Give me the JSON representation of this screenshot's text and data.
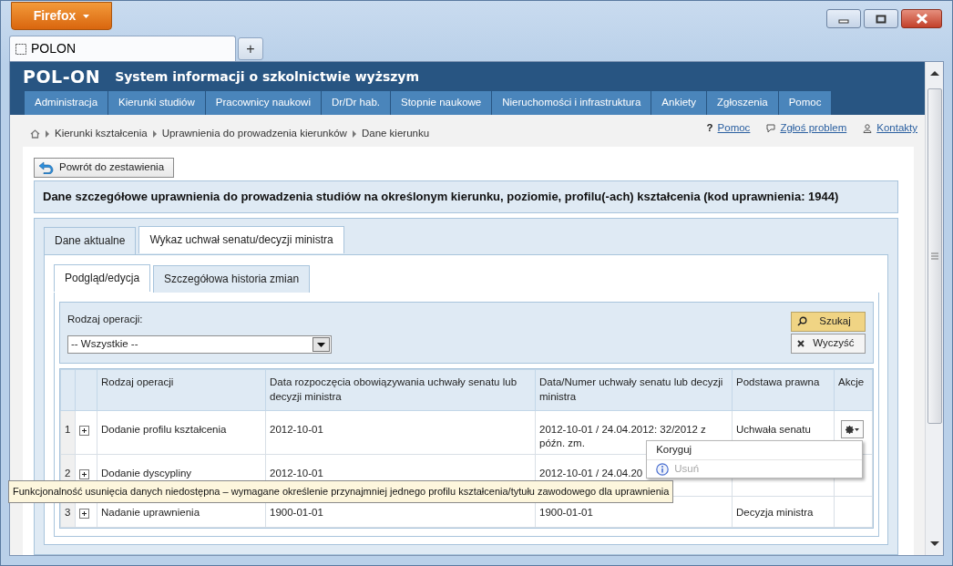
{
  "browser": {
    "menu_button": "Firefox",
    "tabs": [
      {
        "label": "POLON",
        "selected": true
      }
    ],
    "new_tab": "+"
  },
  "header": {
    "logo": "POL-ON",
    "title": "System informacji o szkolnictwie wyższym"
  },
  "nav": [
    {
      "label": "Administracja"
    },
    {
      "label": "Kierunki studiów"
    },
    {
      "label": "Pracownicy naukowi"
    },
    {
      "label": "Dr/Dr hab."
    },
    {
      "label": "Stopnie naukowe"
    },
    {
      "label": "Nieruchomości i infrastruktura"
    },
    {
      "label": "Ankiety"
    },
    {
      "label": "Zgłoszenia"
    },
    {
      "label": "Pomoc"
    }
  ],
  "breadcrumb": [
    "Kierunki kształcenia",
    "Uprawnienia do prowadzenia kierunków",
    "Dane kierunku"
  ],
  "help_links": [
    {
      "kind": "help",
      "glyph": "?",
      "label": "Pomoc"
    },
    {
      "kind": "report",
      "label": "Zgłoś problem"
    },
    {
      "kind": "contact",
      "label": "Kontakty"
    }
  ],
  "back_button": "Powrót do zestawienia",
  "page_title": "Dane szczegółowe uprawnienia do prowadzenia studiów na określonym kierunku, poziomie, profilu(-ach) kształcenia (kod uprawnienia: 1944)",
  "tabs": [
    {
      "label": "Dane aktualne",
      "selected": false
    },
    {
      "label": "Wykaz uchwał senatu/decyzji ministra",
      "selected": true
    }
  ],
  "subtabs": [
    {
      "label": "Podgląd/edycja",
      "selected": true
    },
    {
      "label": "Szczegółowa historia zmian",
      "selected": false
    }
  ],
  "filter": {
    "label": "Rodzaj operacji:",
    "value": "-- Wszystkie --",
    "buttons": [
      {
        "kind": "search",
        "label": "Szukaj"
      },
      {
        "kind": "clear",
        "label": "Wyczyść"
      }
    ]
  },
  "table": {
    "columns": [
      "Rodzaj operacji",
      "Data rozpoczęcia obowiązywania uchwały senatu lub decyzji ministra",
      "Data/Numer uchwały senatu lub decyzji ministra",
      "Podstawa prawna",
      "Akcje"
    ],
    "rows": [
      {
        "number": "1",
        "operation": "Dodanie profilu kształcenia",
        "start_date": "2012-10-01",
        "resolution": "2012-10-01 / 24.04.2012: 32/2012 z późn. zm.",
        "legal_basis": "Uchwała senatu",
        "actions_button": true
      },
      {
        "number": "2",
        "operation": "Dodanie dyscypliny",
        "start_date": "2012-10-01",
        "resolution": "2012-10-01 / 24.04.20",
        "actions_button": false
      },
      {
        "number": "3",
        "operation": "Nadanie uprawnienia",
        "start_date": "1900-01-01",
        "resolution": "1900-01-01",
        "legal_basis": "Decyzja ministra",
        "actions_button": false
      }
    ]
  },
  "action_menu": {
    "items": [
      {
        "label": "Koryguj",
        "disabled": false
      },
      {
        "label": "Usuń",
        "disabled": true
      }
    ]
  },
  "tooltip": "Funkcjonalność usunięcia danych niedostępna – wymagane określenie przynajmniej jednego profilu kształcenia/tytułu zawodowego dla uprawnienia"
}
